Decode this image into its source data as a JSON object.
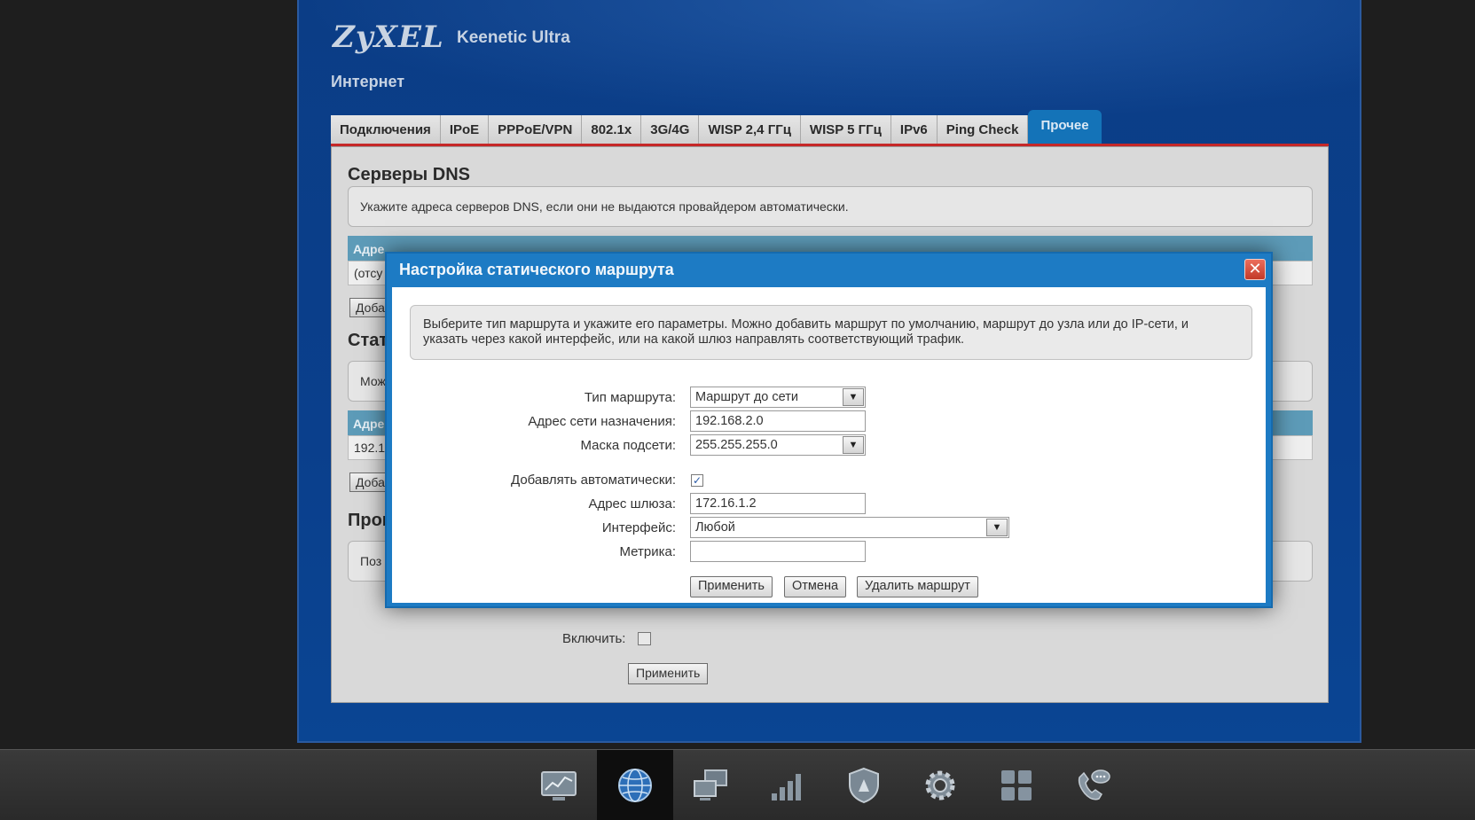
{
  "header": {
    "logo": "ZyXEL",
    "model": "Keenetic Ultra",
    "section": "Интернет"
  },
  "tabs": [
    {
      "label": "Подключения"
    },
    {
      "label": "IPoE"
    },
    {
      "label": "PPPoE/VPN"
    },
    {
      "label": "802.1x"
    },
    {
      "label": "3G/4G"
    },
    {
      "label": "WISP 2,4 ГГц"
    },
    {
      "label": "WISP 5 ГГц"
    },
    {
      "label": "IPv6"
    },
    {
      "label": "Ping Check"
    },
    {
      "label": "Прочее",
      "active": true
    }
  ],
  "panel": {
    "dns_title": "Серверы DNS",
    "dns_info": "Укажите адреса серверов DNS, если они не выдаются провайдером автоматически.",
    "dns_table_head": "Адре",
    "dns_table_row": "(отсу",
    "dns_add": "Доба",
    "routes_title": "Стат",
    "routes_info": "Мож",
    "routes_table_head": "Адре",
    "routes_table_row": "192.1",
    "routes_add": "Доба",
    "proxy_title": "Прог",
    "proxy_info": "Поз",
    "enable_label": "Включить:",
    "enable_checked": false,
    "apply_label": "Применить"
  },
  "modal": {
    "title": "Настройка статического маршрута",
    "close_icon": "close-icon",
    "info_line1": "Выберите тип маршрута и укажите его параметры. Можно добавить маршрут по умолчанию, маршрут до узла или до IP-сети, и",
    "info_line2": "указать через какой интерфейс, или на какой шлюз направлять соответствующий трафик.",
    "route_type_label": "Тип маршрута:",
    "route_type_value": "Маршрут до сети",
    "dest_label": "Адрес сети назначения:",
    "dest_value": "192.168.2.0",
    "mask_label": "Маска подсети:",
    "mask_value": "255.255.255.0",
    "auto_label": "Добавлять автоматически:",
    "auto_checked": true,
    "gateway_label": "Адрес шлюза:",
    "gateway_value": "172.16.1.2",
    "iface_label": "Интерфейс:",
    "iface_value": "Любой",
    "metric_label": "Метрика:",
    "metric_value": "",
    "apply_label": "Применить",
    "cancel_label": "Отмена",
    "delete_label": "Удалить маршрут"
  },
  "dock": [
    {
      "icon": "monitor-chart-icon"
    },
    {
      "icon": "globe-icon",
      "active": true
    },
    {
      "icon": "network-computers-icon"
    },
    {
      "icon": "signal-bars-icon"
    },
    {
      "icon": "shield-icon"
    },
    {
      "icon": "gear-icon"
    },
    {
      "icon": "apps-grid-icon"
    },
    {
      "icon": "phone-chat-icon"
    }
  ],
  "colors": {
    "frame_blue": "#0b3d86",
    "tab_active": "#1473b8",
    "tab_underline": "#c62828",
    "modal_blue": "#1d7bc4",
    "close_red": "#d34a38",
    "table_head": "#5d9bb8"
  }
}
